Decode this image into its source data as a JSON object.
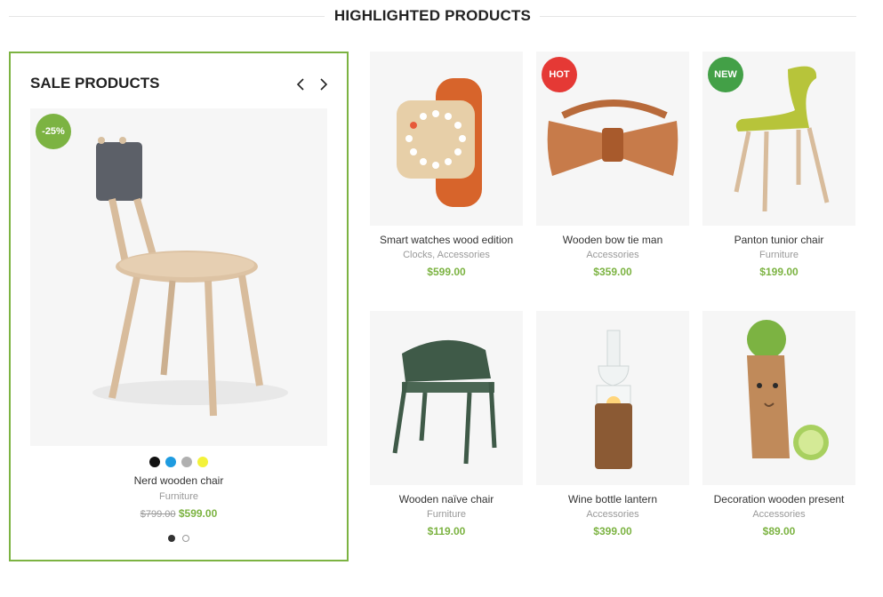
{
  "section": {
    "title": "HIGHLIGHTED PRODUCTS"
  },
  "sale": {
    "title": "SALE PRODUCTS",
    "badge": "-25%",
    "product": {
      "name": "Nerd wooden chair",
      "category": "Furniture",
      "old_price": "$799.00",
      "price": "$599.00"
    },
    "swatches": [
      "#111111",
      "#1e9be0",
      "#b0b0b0",
      "#f3f23a"
    ],
    "accent": "#7cb342"
  },
  "products": [
    {
      "name": "Smart watches wood edition",
      "category": "Clocks, Accessories",
      "price": "$599.00",
      "badge": ""
    },
    {
      "name": "Wooden bow tie man",
      "category": "Accessories",
      "price": "$359.00",
      "badge": "HOT"
    },
    {
      "name": "Panton tunior chair",
      "category": "Furniture",
      "price": "$199.00",
      "badge": "NEW"
    },
    {
      "name": "Wooden naïve chair",
      "category": "Furniture",
      "price": "$119.00",
      "badge": ""
    },
    {
      "name": "Wine bottle lantern",
      "category": "Accessories",
      "price": "$399.00",
      "badge": ""
    },
    {
      "name": "Decoration wooden present",
      "category": "Accessories",
      "price": "$89.00",
      "badge": ""
    }
  ],
  "icons": {
    "prev": "chevron-left-icon",
    "next": "chevron-right-icon"
  }
}
